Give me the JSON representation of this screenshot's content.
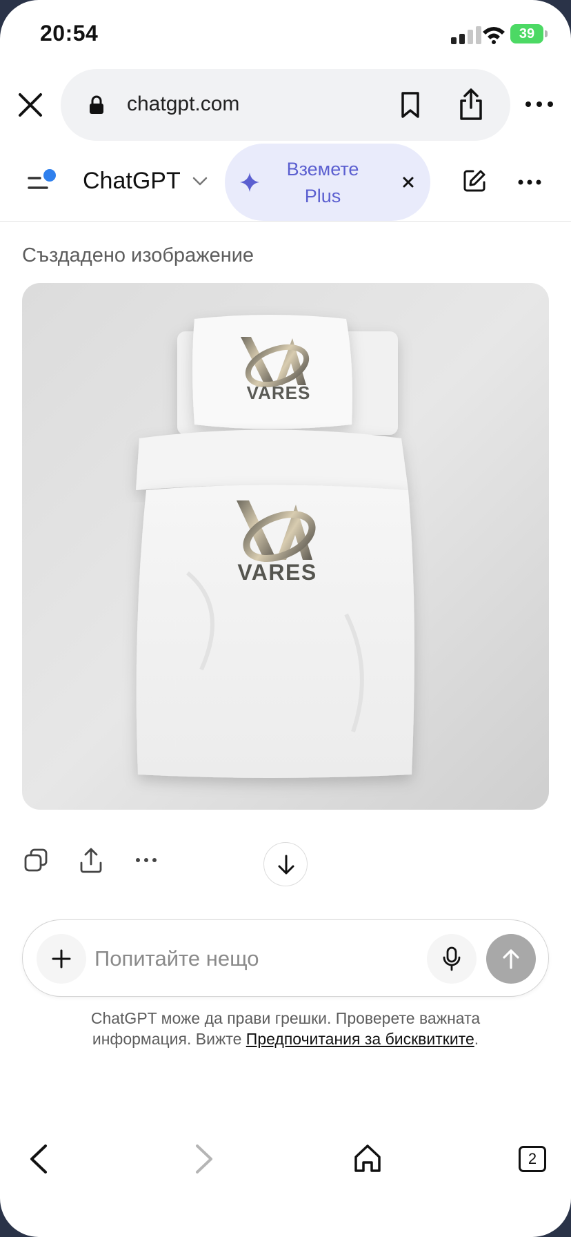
{
  "status_bar": {
    "time": "20:54",
    "battery": "39"
  },
  "browser": {
    "url": "chatgpt.com"
  },
  "header": {
    "title": "ChatGPT",
    "plus_cta_line1": "Вземете",
    "plus_cta_line2": "Plus"
  },
  "message": {
    "label": "Създадено изображение",
    "image": {
      "pillow_logo_text": "VARES",
      "duvet_logo_text": "VARES"
    }
  },
  "composer": {
    "placeholder": "Попитайте нещо"
  },
  "disclaimer": {
    "text": "ChatGPT може да прави грешки. Проверете важната информация. Вижте ",
    "link": "Предпочитания за бисквитките",
    "suffix": "."
  },
  "bottom_bar": {
    "tab_count": "2"
  },
  "colors": {
    "accent": "#5b5fd0",
    "accent_bg": "#e9ebfb",
    "notification_dot": "#2f80ed",
    "battery_green": "#4cd964",
    "send_disabled": "#a8a8a8"
  }
}
